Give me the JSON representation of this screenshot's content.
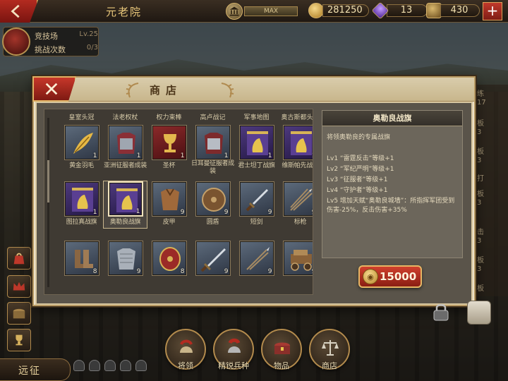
{
  "topbar": {
    "screen_title": "元老院",
    "max_label": "MAX",
    "gold": "281250",
    "gems": "13",
    "third_resource": "430",
    "plus": "+"
  },
  "arena": {
    "name": "竞技场",
    "level": "Lv.25",
    "challenges_label": "挑战次数",
    "challenges_value": "0/3"
  },
  "shop": {
    "title": "商店",
    "columns_header": [
      "皇室头冠",
      "法老权杖",
      "权力束棒",
      "高卢战记",
      "军事地图",
      "奥古斯都头盔"
    ],
    "rows": [
      [
        {
          "name": "黄金羽毛",
          "count": "1",
          "icon": "gold-feather-icon"
        },
        {
          "name": "亚洲征服者成装",
          "count": "1",
          "icon": "armor-icon"
        },
        {
          "name": "圣杯",
          "count": "1",
          "icon": "grail-icon"
        },
        {
          "name": "日耳曼征服者成装",
          "count": "1",
          "icon": "armor-icon"
        },
        {
          "name": "君士坦丁战旗",
          "count": "1",
          "icon": "banner-icon"
        },
        {
          "name": "维斯帕先战旗",
          "count": "1",
          "icon": "banner-icon"
        }
      ],
      [
        {
          "name": "图拉真战旗",
          "count": "1",
          "icon": "banner-icon"
        },
        {
          "name": "奥勒良战旗",
          "count": "1",
          "icon": "banner-icon"
        },
        {
          "name": "皮甲",
          "count": "9",
          "icon": "leather-armor-icon"
        },
        {
          "name": "圆盾",
          "count": "9",
          "icon": "round-shield-icon"
        },
        {
          "name": "短剑",
          "count": "9",
          "icon": "short-sword-icon"
        },
        {
          "name": "标枪",
          "count": "9",
          "icon": "javelin-icon"
        }
      ],
      [
        {
          "name": "",
          "count": "8",
          "icon": "boots-icon"
        },
        {
          "name": "",
          "count": "9",
          "icon": "chainmail-icon"
        },
        {
          "name": "",
          "count": "8",
          "icon": "scutum-shield-icon"
        },
        {
          "name": "",
          "count": "9",
          "icon": "sword-icon"
        },
        {
          "name": "",
          "count": "9",
          "icon": "spear-icon"
        },
        {
          "name": "",
          "count": "9",
          "icon": "supply-cart-icon"
        }
      ]
    ],
    "detail": {
      "title": "奥勒良战旗",
      "description": "将领奥勒良的专属战旗",
      "levels": [
        "Lv1 “雷霆反击”等级+1",
        "Lv2 “军纪严明”等级+1",
        "Lv3 “征服者”等级+1",
        "Lv4 “守护者”等级+1",
        "Lv5 增加天赋“奥勒良城墙”：所指挥军团受到伤害-25%，反击伤害+35%"
      ],
      "price": "15000"
    }
  },
  "right_strip": [
    "练",
    "17",
    "板",
    "3",
    "板",
    "3",
    "打",
    "板",
    "3",
    "击",
    "3",
    "板",
    "3",
    "板",
    "3"
  ],
  "bottom_nav": {
    "expedition": "远征",
    "items": [
      {
        "label": "将领",
        "icon": "helmet-icon"
      },
      {
        "label": "精锐兵种",
        "icon": "legion-helmet-icon"
      },
      {
        "label": "物品",
        "icon": "chest-icon"
      },
      {
        "label": "商店",
        "icon": "scales-icon"
      }
    ]
  },
  "colors": {
    "accent_red": "#b32b20",
    "gold_border": "#d8a957",
    "panel_dark": "#3f3a33",
    "banner_purple": "#4e3a7e"
  }
}
